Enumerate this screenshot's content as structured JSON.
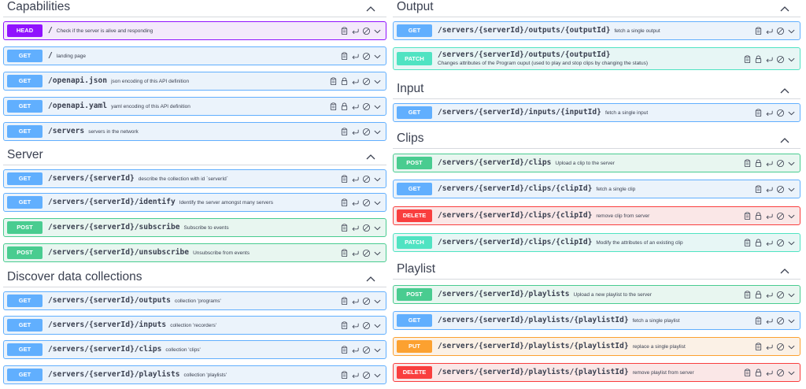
{
  "colors": {
    "get": "#61affe",
    "post": "#49cc90",
    "head": "#9012fe",
    "patch": "#50e3c2",
    "put": "#fca130",
    "delete": "#f93e3e",
    "text": "#3b4151"
  },
  "sections": {
    "capabilities": {
      "title": "Capabilities",
      "ops": [
        {
          "method": "HEAD",
          "path": "/",
          "desc": "Check if the server is alive and responding",
          "lock": false
        },
        {
          "method": "GET",
          "path": "/",
          "desc": "landing page",
          "lock": false
        },
        {
          "method": "GET",
          "path": "/openapi.json",
          "desc": "json encoding of this API definition",
          "lock": true
        },
        {
          "method": "GET",
          "path": "/openapi.yaml",
          "desc": "yaml encoding of this API definition",
          "lock": true
        },
        {
          "method": "GET",
          "path": "/servers",
          "desc": "servers in the network",
          "lock": false
        }
      ]
    },
    "server": {
      "title": "Server",
      "ops": [
        {
          "method": "GET",
          "path": "/servers/{serverId}",
          "desc": "describe the collection with id `serverId`",
          "lock": false
        },
        {
          "method": "GET",
          "path": "/servers/{serverId}/identify",
          "desc": "Identify the server amongst many servers",
          "lock": false
        },
        {
          "method": "POST",
          "path": "/servers/{serverId}/subscribe",
          "desc": "Subscribe to events",
          "lock": false
        },
        {
          "method": "POST",
          "path": "/servers/{serverId}/unsubscribe",
          "desc": "Unsubscribe from events",
          "lock": false
        }
      ]
    },
    "discover": {
      "title": "Discover data collections",
      "ops": [
        {
          "method": "GET",
          "path": "/servers/{serverId}/outputs",
          "desc": "collection 'programs'",
          "lock": false
        },
        {
          "method": "GET",
          "path": "/servers/{serverId}/inputs",
          "desc": "collection 'recorders'",
          "lock": false
        },
        {
          "method": "GET",
          "path": "/servers/{serverId}/clips",
          "desc": "collection 'clips'",
          "lock": false
        },
        {
          "method": "GET",
          "path": "/servers/{serverId}/playlists",
          "desc": "collection 'playlists'",
          "lock": false
        }
      ]
    },
    "output": {
      "title": "Output",
      "ops": [
        {
          "method": "GET",
          "path": "/servers/{serverId}/outputs/{outputId}",
          "desc": "fetch a single output",
          "lock": false
        },
        {
          "method": "PATCH",
          "path": "/servers/{serverId}/outputs/{outputId}",
          "desc": "Changes attributes of the Program ouput (used to play and stop clips by changing the status)",
          "lock": true
        }
      ]
    },
    "input": {
      "title": "Input",
      "ops": [
        {
          "method": "GET",
          "path": "/servers/{serverId}/inputs/{inputId}",
          "desc": "fetch a single input",
          "lock": false
        }
      ]
    },
    "clips": {
      "title": "Clips",
      "ops": [
        {
          "method": "POST",
          "path": "/servers/{serverId}/clips",
          "desc": "Upload a clip to the server",
          "lock": true
        },
        {
          "method": "GET",
          "path": "/servers/{serverId}/clips/{clipId}",
          "desc": "fetch a single clip",
          "lock": false
        },
        {
          "method": "DELETE",
          "path": "/servers/{serverId}/clips/{clipId}",
          "desc": "remove clip from server",
          "lock": true
        },
        {
          "method": "PATCH",
          "path": "/servers/{serverId}/clips/{clipId}",
          "desc": "Modify the attributes of an existing clip",
          "lock": true
        }
      ]
    },
    "playlist": {
      "title": "Playlist",
      "ops": [
        {
          "method": "POST",
          "path": "/servers/{serverId}/playlists",
          "desc": "Upload a new playlist to the server",
          "lock": true
        },
        {
          "method": "GET",
          "path": "/servers/{serverId}/playlists/{playlistId}",
          "desc": "fetch a single playlist",
          "lock": false
        },
        {
          "method": "PUT",
          "path": "/servers/{serverId}/playlists/{playlistId}",
          "desc": "replace a single playlist",
          "lock": false
        },
        {
          "method": "DELETE",
          "path": "/servers/{serverId}/playlists/{playlistId}",
          "desc": "remove playlist from server",
          "lock": true
        }
      ]
    }
  },
  "icons": {
    "copy": "clipboard-icon",
    "lock": "lock-icon",
    "link": "link-arrow-icon",
    "deprecated": "circle-slash-icon",
    "expand": "chevron-down-icon",
    "collapse": "chevron-up-icon"
  }
}
